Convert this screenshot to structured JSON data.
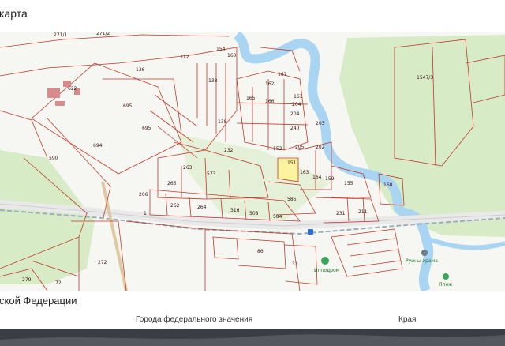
{
  "header": {
    "title": "карта"
  },
  "map": {
    "colors": {
      "background": "#f6f7f2",
      "forest": "#d6ebc6",
      "river": "#a9d4f2",
      "parcel_line": "#c0392b",
      "selected_parcel": "#fcf3a0",
      "road": "#e9e9e9",
      "railway": "#9aaebc"
    },
    "parcel_labels": [
      "271/1",
      "271/2",
      "312",
      "154",
      "622",
      "160",
      "136",
      "138",
      "162",
      "167",
      "161",
      "204",
      "1547/3",
      "695",
      "165",
      "166",
      "204",
      "203",
      "695",
      "138",
      "240",
      "694",
      "232",
      "152",
      "205",
      "202",
      "590",
      "263",
      "573",
      "151",
      "163",
      "164",
      "159",
      "155",
      "168",
      "265",
      "206",
      "585",
      "262",
      "264",
      "316",
      "508",
      "584",
      "231",
      "211",
      "272",
      "86",
      "33",
      "279",
      "72"
    ],
    "road_label": "1",
    "poi": [
      {
        "label": "Ипподром",
        "icon": "hippodrome-icon"
      },
      {
        "label": "Руины храма",
        "icon": "ruins-icon"
      },
      {
        "label": "Пляж",
        "icon": "beach-icon"
      }
    ]
  },
  "panel": {
    "section_title": "ской Федерации",
    "columns": [
      "Города федерального значения",
      "Края"
    ]
  },
  "strip": {
    "color": "#3a3d44"
  }
}
